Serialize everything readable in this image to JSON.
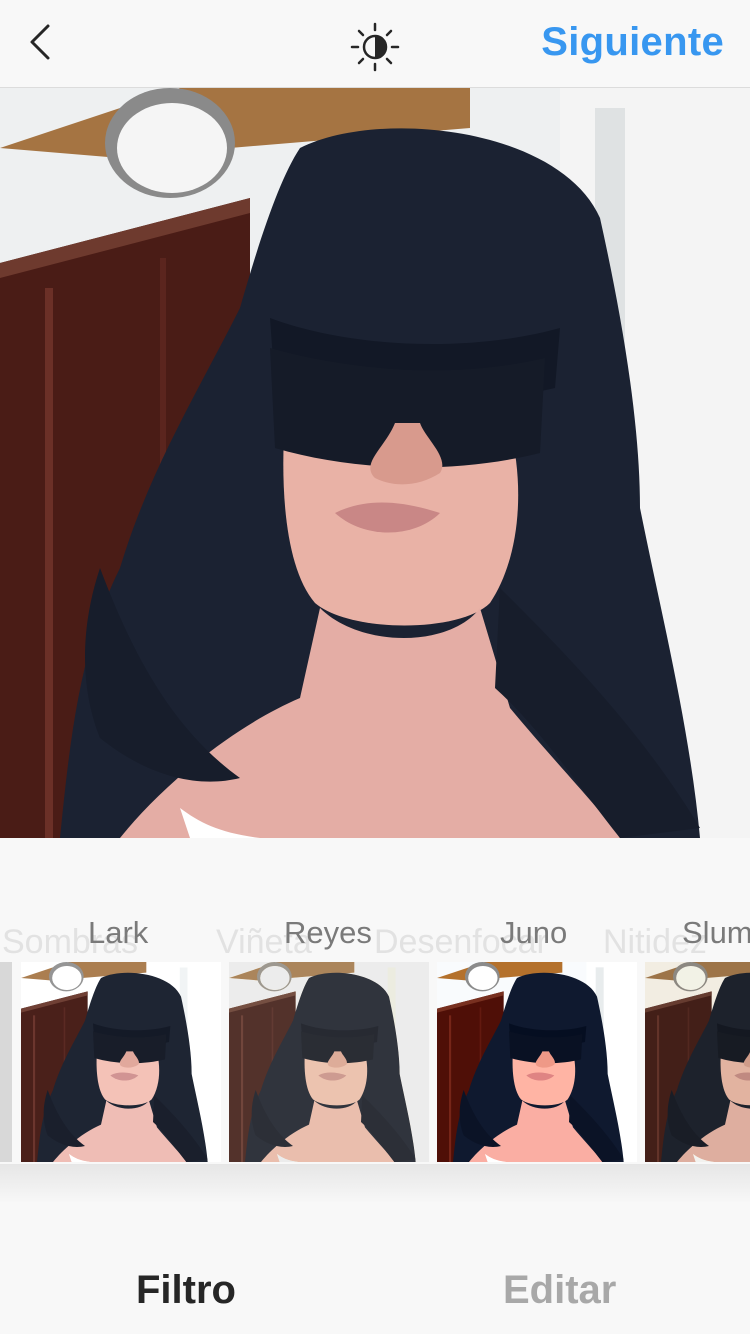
{
  "header": {
    "back_icon": "chevron-left-icon",
    "lux_icon": "lux-brightness-icon",
    "next_label": "Siguiente"
  },
  "photo": {
    "description_icon": "photo-preview"
  },
  "tool_labels": [
    "Sombras",
    "Viñeta",
    "Desenfocar",
    "Nitidez"
  ],
  "filters": [
    {
      "label": "Lark"
    },
    {
      "label": "Reyes"
    },
    {
      "label": "Juno"
    },
    {
      "label": "Slum"
    }
  ],
  "tabs": {
    "filter_label": "Filtro",
    "edit_label": "Editar"
  },
  "colors": {
    "accent": "#3897f0",
    "active_tab": "#262626",
    "inactive_tab": "#a8a8a8"
  }
}
